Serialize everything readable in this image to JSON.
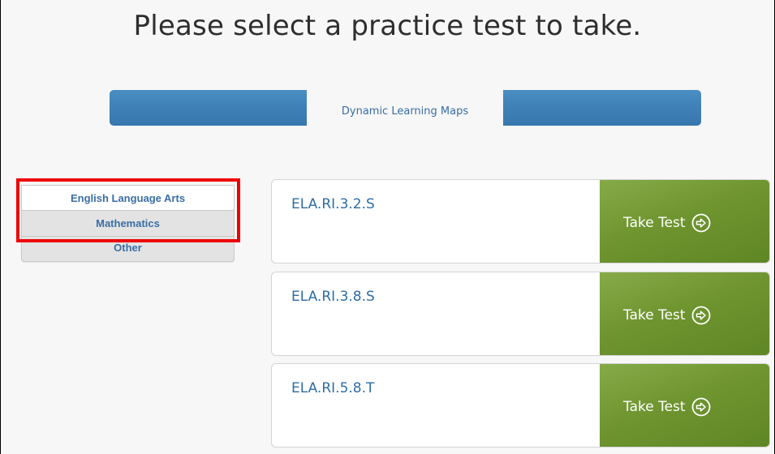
{
  "page": {
    "title": "Please select a practice test to take."
  },
  "program_tabs": {
    "selected": "Dynamic Learning Maps"
  },
  "subjects": [
    {
      "label": "English Language Arts",
      "active": true
    },
    {
      "label": "Mathematics",
      "active": false
    },
    {
      "label": "Other",
      "active": false
    }
  ],
  "tests": [
    {
      "name": "ELA.RI.3.2.S",
      "button_label": "Take Test"
    },
    {
      "name": "ELA.RI.3.8.S",
      "button_label": "Take Test"
    },
    {
      "name": "ELA.RI.5.8.T",
      "button_label": "Take Test"
    }
  ],
  "icons": {
    "take_test": "arrow-circle-right-icon"
  },
  "colors": {
    "program_bar": "#3f80b6",
    "link_text": "#2e6da4",
    "take_test_button": "#6f9530",
    "highlight": "#ee0000"
  }
}
